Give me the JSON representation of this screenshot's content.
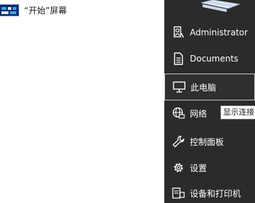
{
  "start_screen_link": {
    "label": "“开始”屏幕",
    "icon": "start-screen-thumbnail-icon"
  },
  "menu": {
    "items": [
      {
        "label": "Administrator",
        "icon": "user-icon"
      },
      {
        "label": "Documents",
        "icon": "document-icon"
      },
      {
        "label": "此电脑",
        "icon": "computer-icon",
        "selected": true
      },
      {
        "label": "网络",
        "icon": "network-icon"
      },
      {
        "label": "控制面板",
        "icon": "wrench-icon"
      },
      {
        "label": "设置",
        "icon": "gear-icon"
      },
      {
        "label": "设备和打印机",
        "icon": "printer-icon"
      }
    ]
  },
  "tooltip": {
    "text": "显示连接"
  },
  "colors": {
    "menu_background": "#2b2b2b",
    "menu_text": "#ffffff",
    "selection_border": "#c8c8c8"
  }
}
